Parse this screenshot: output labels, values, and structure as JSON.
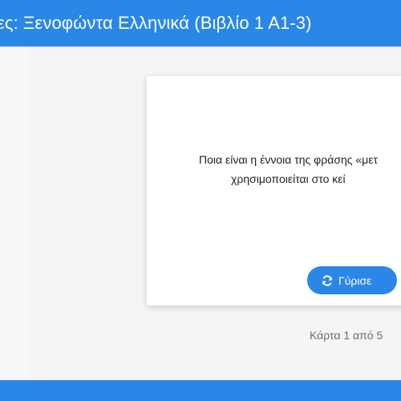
{
  "header": {
    "title": "ες: Ξενοφώντα Ελληνικά (Βιβλίο 1 Α1-3)"
  },
  "card": {
    "question_line1": "Ποια είναι η έννοια της φράσης «μετ",
    "question_line2": "χρησιμοποιείται στο κεί"
  },
  "flip_button": {
    "label": "Γύρισε",
    "icon": "refresh-icon"
  },
  "counter": "Κάρτα 1 από 5",
  "colors": {
    "accent": "#2a87e8",
    "background": "#f4f5f6",
    "card": "#ffffff"
  }
}
